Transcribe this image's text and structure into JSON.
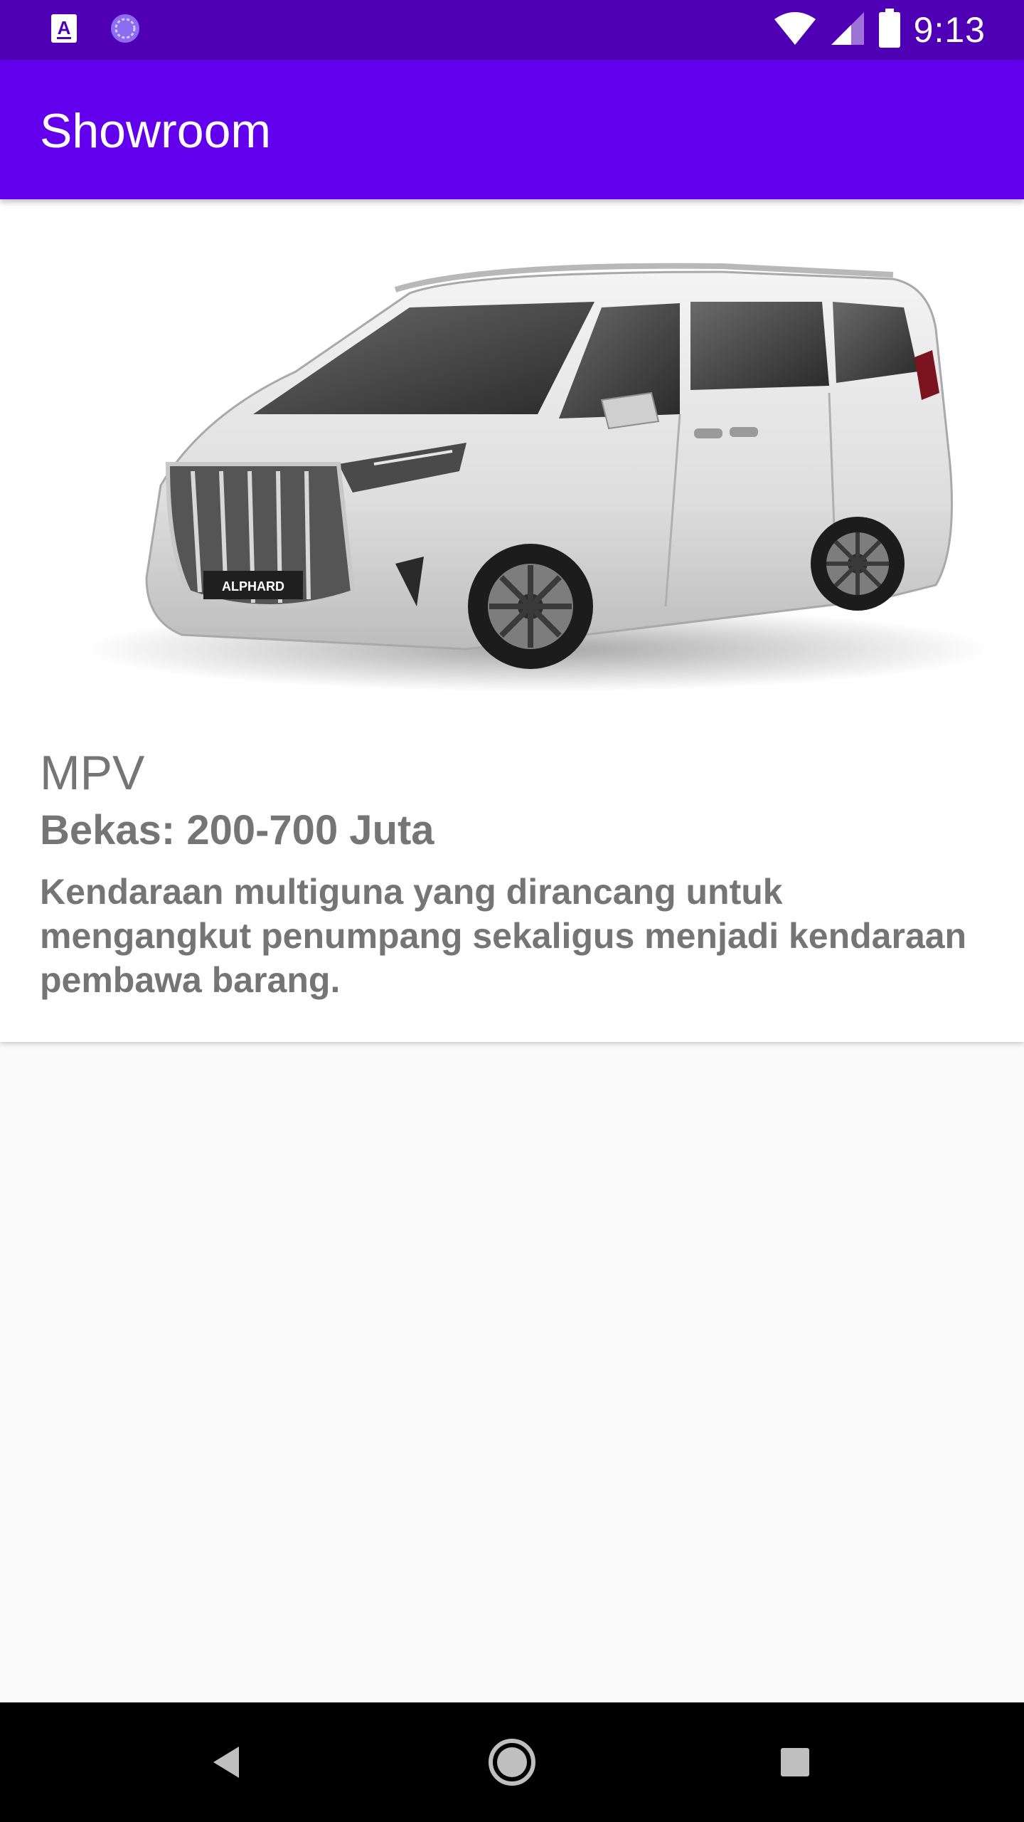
{
  "status_bar": {
    "time": "9:13",
    "icons": [
      "app-a-icon",
      "sync-icon",
      "wifi-icon",
      "cellular-signal-icon",
      "battery-icon"
    ],
    "background": "#4f00b5"
  },
  "app_bar": {
    "title": "Showroom",
    "background": "#6200ee"
  },
  "card": {
    "image_icon": "car-image",
    "type": "MPV",
    "price": "Bekas: 200-700 Juta",
    "description": "Kendaraan multiguna yang dirancang untuk mengangkut penumpang sekaligus menjadi kendaraan pembawa barang.",
    "image_text": "ALPHARD"
  },
  "nav_bar": {
    "icons": [
      "back-icon",
      "home-icon",
      "recents-icon"
    ],
    "background": "#000000"
  }
}
